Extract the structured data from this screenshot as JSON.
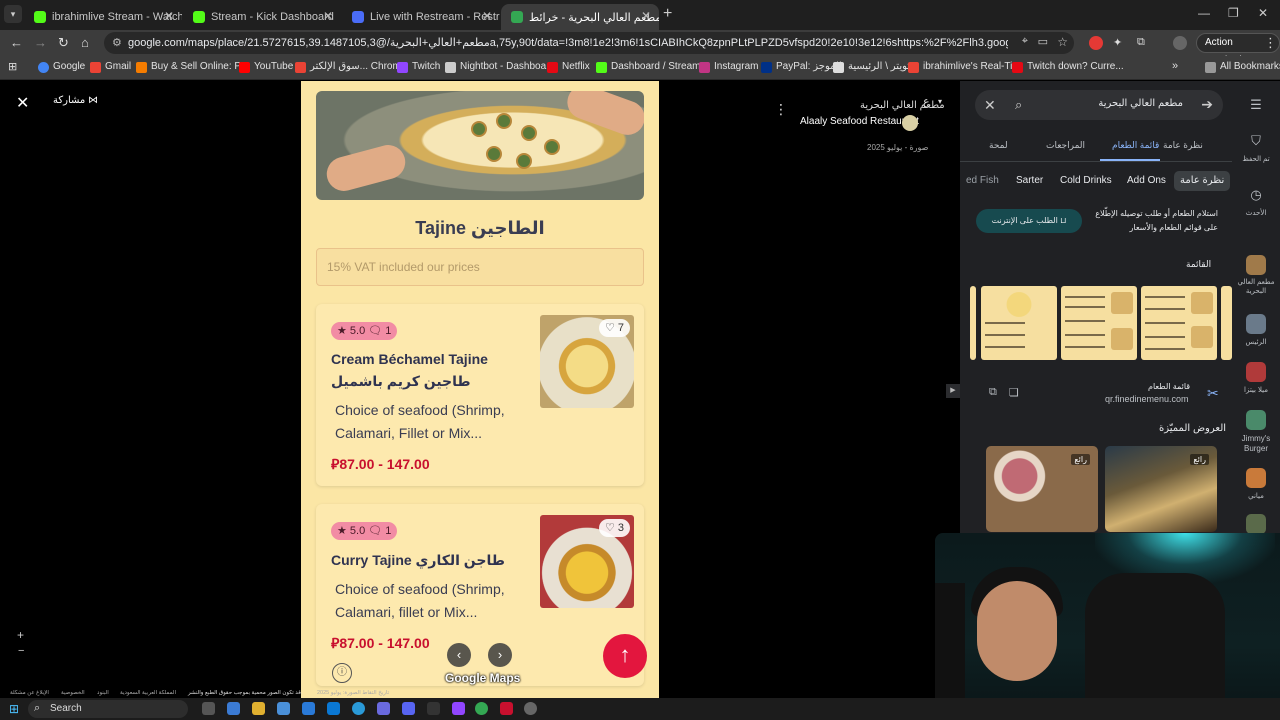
{
  "browser": {
    "tabs": [
      {
        "title": "ibrahimlive Stream - Watch Live",
        "color": "#53fc18"
      },
      {
        "title": "Stream - Kick Dashboard",
        "color": "#53fc18"
      },
      {
        "title": "Live with Restream - Restream",
        "color": "#4a6cf7"
      },
      {
        "title": "مطعم العالي البحرية - خرائط Google",
        "color": "#34a853"
      }
    ],
    "url": "google.com/maps/place/مطعم+العالي+البحرية/@21.5727615,39.1487105,3a,75y,90t/data=!3m8!1e2!3m6!1sCIABIhCkQ8zpnPLtPLPZD5vfspd20!2e10!3e12!6shttps:%2F%2Flh3.googleusercontent.com%...",
    "action_required": "Action required",
    "bookmarks": [
      {
        "label": "Google",
        "color": "#4285f4"
      },
      {
        "label": "Gmail",
        "color": "#ea4335"
      },
      {
        "label": "Buy & Sell Online: P...",
        "color": "#f57c00"
      },
      {
        "label": "YouTube",
        "color": "#ff0000"
      },
      {
        "label": "سوق الإلكتر... Chrome",
        "color": "#ea4335"
      },
      {
        "label": "Twitch",
        "color": "#9146ff"
      },
      {
        "label": "Nightbot - Dashboa...",
        "color": "#cccccc"
      },
      {
        "label": "Netflix",
        "color": "#e50914"
      },
      {
        "label": "Dashboard / Stream...",
        "color": "#53fc18"
      },
      {
        "label": "Instagram",
        "color": "#c13584"
      },
      {
        "label": "PayPal: الموجز",
        "color": "#003087"
      },
      {
        "label": "تويتر \\ الرئيسية",
        "color": "#dddddd"
      },
      {
        "label": "ibrahimlive's Real-Ti...",
        "color": "#ea4335"
      },
      {
        "label": "Twitch down? Curre...",
        "color": "#e50914"
      }
    ],
    "all_bookmarks": "All Bookmarks"
  },
  "viewer": {
    "share_label": "مشاركة",
    "restaurant_ar": "مطعم العالي البحرية",
    "restaurant_en": "Alaaly Seafood Restaurant",
    "photo_date": "صورة - يوليو 2025",
    "attribution_letter": "ع"
  },
  "menu": {
    "section_title": "Tajine الطاجين",
    "vat_note": "15% VAT included our prices",
    "items": [
      {
        "rating": "5.0",
        "comments": "1",
        "likes": "7",
        "name_en": "Cream Béchamel Tajine",
        "name_ar": "طاجين كريم باشميل",
        "desc": "Choice of seafood (Shrimp, Calamari, Fillet or Mix...",
        "price": "87.00 - 147.00"
      },
      {
        "rating": "5.0",
        "comments": "1",
        "likes": "3",
        "name_en": "Curry Tajine طاجن الكاري",
        "desc": "Choice of seafood (Shrimp, Calamari, fillet or Mix...",
        "price": "87.00 - 147.00"
      }
    ],
    "watermark": "Google Maps"
  },
  "panel": {
    "search_text": "مطعم العالي البحرية",
    "tabs": [
      "نظرة عامة",
      "قائمة الطعام",
      "المراجعات",
      "لمحة"
    ],
    "chips": [
      "نظرة عامة",
      "Add Ons",
      "Cold Drinks",
      "Sarter",
      "ed Fish"
    ],
    "order_desc": "استلام الطعام أو طلب توصيله الإطّلاع على قوائم الطعام والأسعار",
    "order_button": "الطلب على الإنترنت",
    "menu_heading": "القائمة",
    "menu_source_title": "قائمة الطعام",
    "menu_source_url": "qr.finedinemenu.com",
    "featured_heading": "العروض المميّزة",
    "featured_label": "رائع"
  },
  "rail": {
    "items": [
      {
        "label": "تم الحفظ"
      },
      {
        "label": "الأحدث"
      },
      {
        "label": "مطعم العالي البحرية"
      },
      {
        "label": "الرئيس"
      },
      {
        "label": "ميلا بيتزا"
      },
      {
        "label": "Jimmy's Burger"
      },
      {
        "label": "مياني"
      }
    ]
  },
  "footer": {
    "links": [
      "الإبلاغ عن مشكلة",
      "الخصوصية",
      "البنود",
      "المملكة العربية السعودية",
      "قد تكون الصور محمية بموجب حقوق الطبع والنشر.",
      "تاريخ التقاط الصورة: يوليو 2025"
    ]
  },
  "taskbar": {
    "search_label": "Search"
  }
}
